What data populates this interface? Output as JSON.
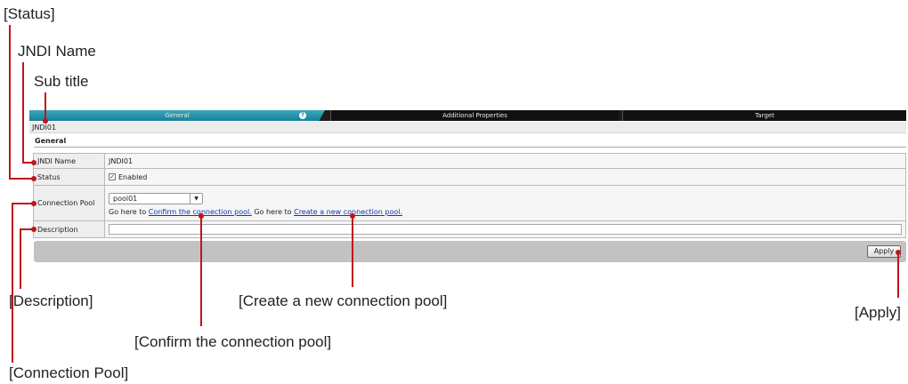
{
  "callouts": {
    "status": "[Status]",
    "jndi_name": "JNDI Name",
    "sub_title": "Sub title",
    "description": "[Description]",
    "create_pool": "[Create a new connection pool]",
    "apply": "[Apply]",
    "confirm_pool": "[Confirm the connection pool]",
    "connection_pool": "[Connection Pool]"
  },
  "tabs": [
    {
      "label": "General",
      "active": true
    },
    {
      "label": "Additional Properties",
      "active": false
    },
    {
      "label": "Target",
      "active": false
    }
  ],
  "help_icon": "?",
  "subtitle": "JNDI01",
  "section": {
    "title": "General"
  },
  "form": {
    "jndi_name": {
      "label": "JNDI Name",
      "value": "JNDI01"
    },
    "status": {
      "label": "Status",
      "checkbox_label": "Enabled",
      "checked": true
    },
    "connection_pool": {
      "label": "Connection Pool",
      "selected": "pool01",
      "prefix_1": "Go here to ",
      "confirm_link": "Confirm the connection pool.",
      "prefix_2": " Go here to ",
      "create_link": "Create a new connection pool."
    },
    "description": {
      "label": "Description",
      "value": ""
    }
  },
  "apply_button": "Apply",
  "colors": {
    "accent": "#167f95",
    "callout": "#c0141b",
    "link": "#1133bb"
  }
}
